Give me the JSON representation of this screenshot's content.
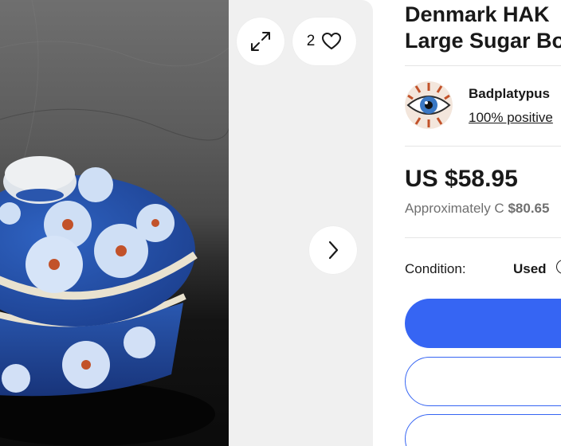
{
  "gallery": {
    "watch_count": "2",
    "colors": {
      "background": "#f0f0f0",
      "button": "#ffffff"
    },
    "icons": {
      "expand": "expand-arrows-icon",
      "watch": "heart-icon",
      "next": "chevron-right-icon"
    }
  },
  "listing": {
    "title_line1": "Denmark HAK",
    "title_line2": "Large Sugar Bo"
  },
  "seller": {
    "name": "Badplatypus",
    "feedback": "100% positive"
  },
  "pricing": {
    "price": "US $58.95",
    "approx_prefix": "Approximately C",
    "approx_value": "$80.65"
  },
  "condition": {
    "label": "Condition:",
    "value": "Used"
  },
  "colors": {
    "accent": "#3665f3",
    "text": "#191919",
    "muted": "#707070"
  }
}
